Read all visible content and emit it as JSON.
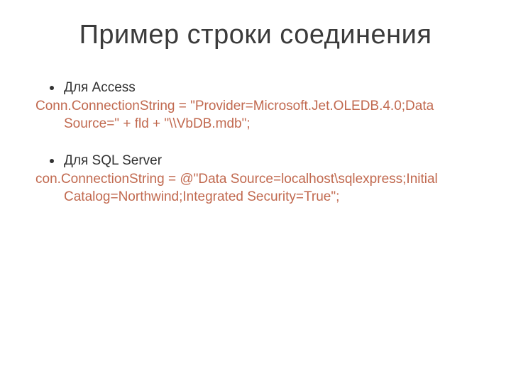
{
  "title": "Пример строки соединения",
  "sections": [
    {
      "bullet": "Для Access",
      "code": "Conn.ConnectionString = \"Provider=Microsoft.Jet.OLEDB.4.0;Data Source=\" + fld + \"\\\\VbDB.mdb\";"
    },
    {
      "bullet": "Для SQL Server",
      "code": "con.ConnectionString = @\"Data Source=localhost\\sqlexpress;Initial Catalog=Northwind;Integrated Security=True\";"
    }
  ]
}
